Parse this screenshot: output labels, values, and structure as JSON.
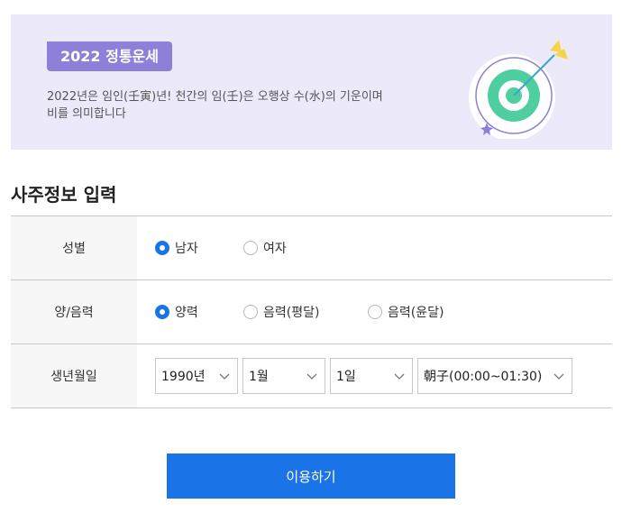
{
  "banner": {
    "badge": "2022 정통운세",
    "desc_line1": "2022년은 임인(壬寅)년! 천간의 임(壬)은 오행상 수(水)의 기운이며",
    "desc_line2": "비를 의미합니다"
  },
  "section_title": "사주정보 입력",
  "form": {
    "gender": {
      "label": "성별",
      "options": [
        "남자",
        "여자"
      ],
      "selected": "남자"
    },
    "calendar": {
      "label": "양/음력",
      "options": [
        "양력",
        "음력(평달)",
        "음력(윤달)"
      ],
      "selected": "양력"
    },
    "birth": {
      "label": "생년월일",
      "year": "1990년",
      "month": "1월",
      "day": "1일",
      "time": "朝子(00:00~01:30)"
    }
  },
  "submit_label": "이용하기",
  "colors": {
    "accent": "#1a74e8",
    "banner_bg": "#ece9fb",
    "badge_bg": "#8e7fd8",
    "target_green": "#4fcf9f"
  }
}
